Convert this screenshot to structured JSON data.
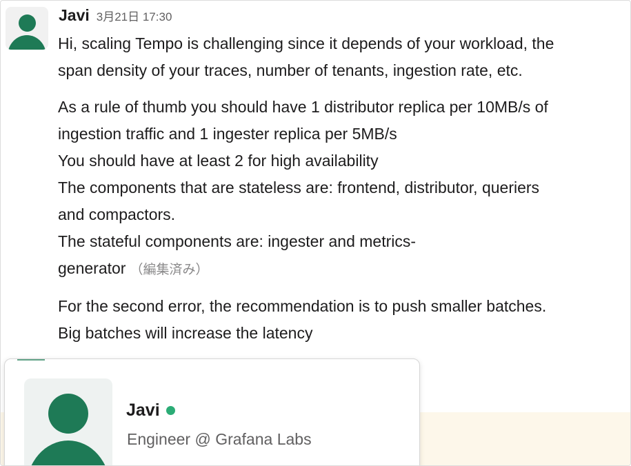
{
  "message": {
    "sender": "Javi",
    "timestamp": "3月21日 17:30",
    "paragraphs": [
      [
        "Hi, scaling Tempo is challenging since it depends of your workload, the",
        "span density of your traces, number of tenants, ingestion rate, etc."
      ],
      [
        "As a rule of thumb you should have 1 distributor replica per 10MB/s of",
        "ingestion traffic and 1 ingester replica per 5MB/s",
        "You should have at least 2 for high availability",
        "The components that are stateless are: frontend, distributor, queriers",
        "and compactors.",
        "The stateful components are: ingester and metrics-",
        "generator"
      ],
      [
        "For the second error, the recommendation is to push smaller batches.",
        "Big batches will increase the latency"
      ]
    ],
    "edited_label": "（編集済み）"
  },
  "profile_card": {
    "name": "Javi",
    "status": "active",
    "title": "Engineer @ Grafana Labs"
  },
  "colors": {
    "avatar_green": "#1e7a56",
    "status_green": "#2bac76",
    "beige_background": "#fdf7ea"
  },
  "icons": {
    "avatar": "person-silhouette-icon",
    "presence": "online-status-dot"
  }
}
